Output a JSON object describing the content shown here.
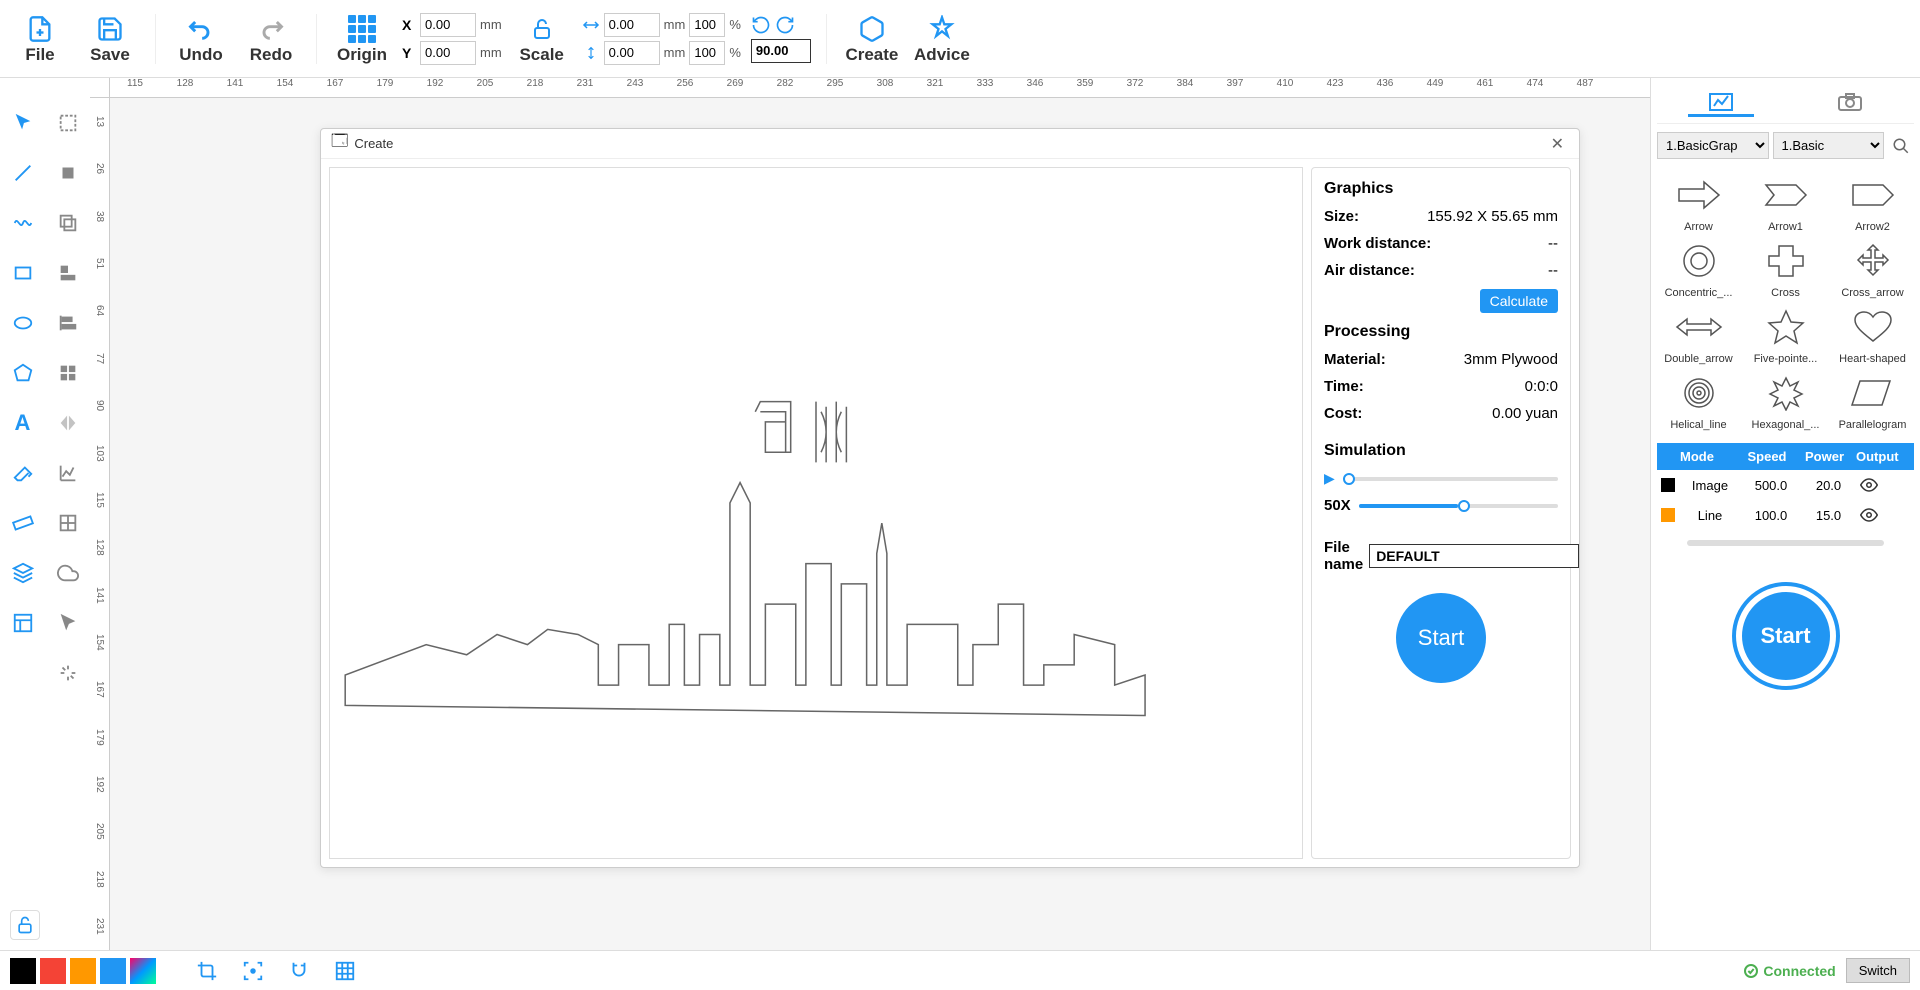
{
  "toolbar": {
    "file": "File",
    "save": "Save",
    "undo": "Undo",
    "redo": "Redo",
    "origin": "Origin",
    "scale": "Scale",
    "create": "Create",
    "advice": "Advice",
    "x_label": "X",
    "y_label": "Y",
    "x_value": "0.00",
    "y_value": "0.00",
    "mm": "mm",
    "w_value": "0.00",
    "h_value": "0.00",
    "w_pct": "100",
    "h_pct": "100",
    "pct": "%",
    "rotate_value": "90.00"
  },
  "ruler_h": [
    "115",
    "128",
    "141",
    "154",
    "167",
    "179",
    "192",
    "205",
    "218",
    "231",
    "243",
    "256",
    "269",
    "282",
    "295",
    "308",
    "321",
    "333",
    "346",
    "359",
    "372",
    "384",
    "397",
    "410",
    "423",
    "436",
    "449",
    "461",
    "474",
    "487"
  ],
  "ruler_v": [
    "13",
    "26",
    "38",
    "51",
    "64",
    "77",
    "90",
    "103",
    "115",
    "128",
    "141",
    "154",
    "167",
    "179",
    "192",
    "205",
    "218",
    "231"
  ],
  "dialog": {
    "title": "Create",
    "graphics": {
      "title": "Graphics",
      "size_label": "Size:",
      "size_value": "155.92 X 55.65 mm",
      "work_label": "Work distance:",
      "work_value": "--",
      "air_label": "Air distance:",
      "air_value": "--",
      "calculate": "Calculate"
    },
    "processing": {
      "title": "Processing",
      "material_label": "Material:",
      "material_value": "3mm Plywood",
      "time_label": "Time:",
      "time_value": "0:0:0",
      "cost_label": "Cost:",
      "cost_value": "0.00 yuan"
    },
    "simulation": {
      "title": "Simulation",
      "speed_label": "50X"
    },
    "filename_label": "File name",
    "filename_value": "DEFAULT",
    "start": "Start"
  },
  "right": {
    "select1": "1.BasicGrap",
    "select2": "1.Basic",
    "shapes": [
      "Arrow",
      "Arrow1",
      "Arrow2",
      "Concentric_...",
      "Cross",
      "Cross_arrow",
      "Double_arrow",
      "Five-pointe...",
      "Heart-shaped",
      "Helical_line",
      "Hexagonal_...",
      "Parallelogram"
    ],
    "layers": {
      "header": [
        "Mode",
        "Speed",
        "Power",
        "Output"
      ],
      "rows": [
        {
          "color": "#000000",
          "mode": "Image",
          "speed": "500.0",
          "power": "20.0"
        },
        {
          "color": "#FF9800",
          "mode": "Line",
          "speed": "100.0",
          "power": "15.0"
        }
      ]
    },
    "start": "Start"
  },
  "bottom": {
    "colors": [
      "#000000",
      "#F44336",
      "#FF9800",
      "#2196F3",
      "#E91E63"
    ],
    "connected": "Connected",
    "switch": "Switch"
  }
}
